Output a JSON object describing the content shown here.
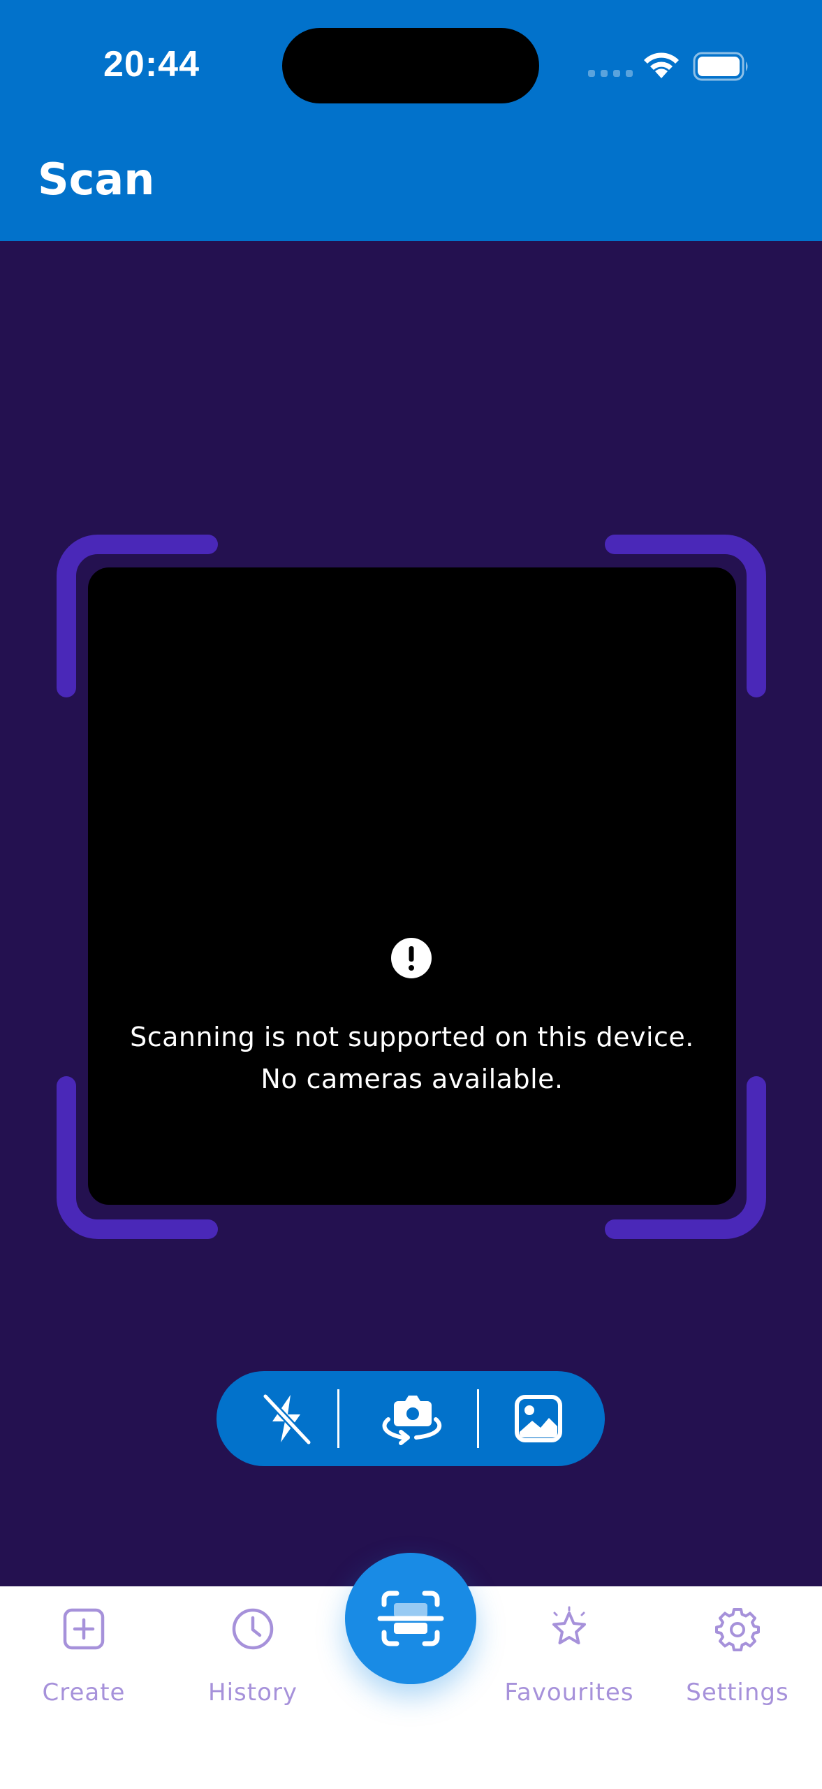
{
  "status_bar": {
    "time": "20:44"
  },
  "header": {
    "title": "Scan"
  },
  "scanner": {
    "message_line1": "Scanning is not supported on this device.",
    "message_line2": "No cameras available."
  },
  "controls": [
    {
      "icon": "flash-off-icon"
    },
    {
      "icon": "switch-camera-icon"
    },
    {
      "icon": "gallery-icon"
    }
  ],
  "tabs": [
    {
      "label": "Create",
      "icon": "plus-square-icon"
    },
    {
      "label": "History",
      "icon": "clock-icon"
    },
    {
      "label": "Favourites",
      "icon": "star-icon"
    },
    {
      "label": "Settings",
      "icon": "gear-icon"
    }
  ],
  "fab": {
    "icon": "scan-icon"
  },
  "colors": {
    "primary": "#0272CB",
    "background": "#241150",
    "frame_accent": "#4A28B8",
    "tab_inactive": "#A691DA",
    "fab": "#198BE5"
  }
}
